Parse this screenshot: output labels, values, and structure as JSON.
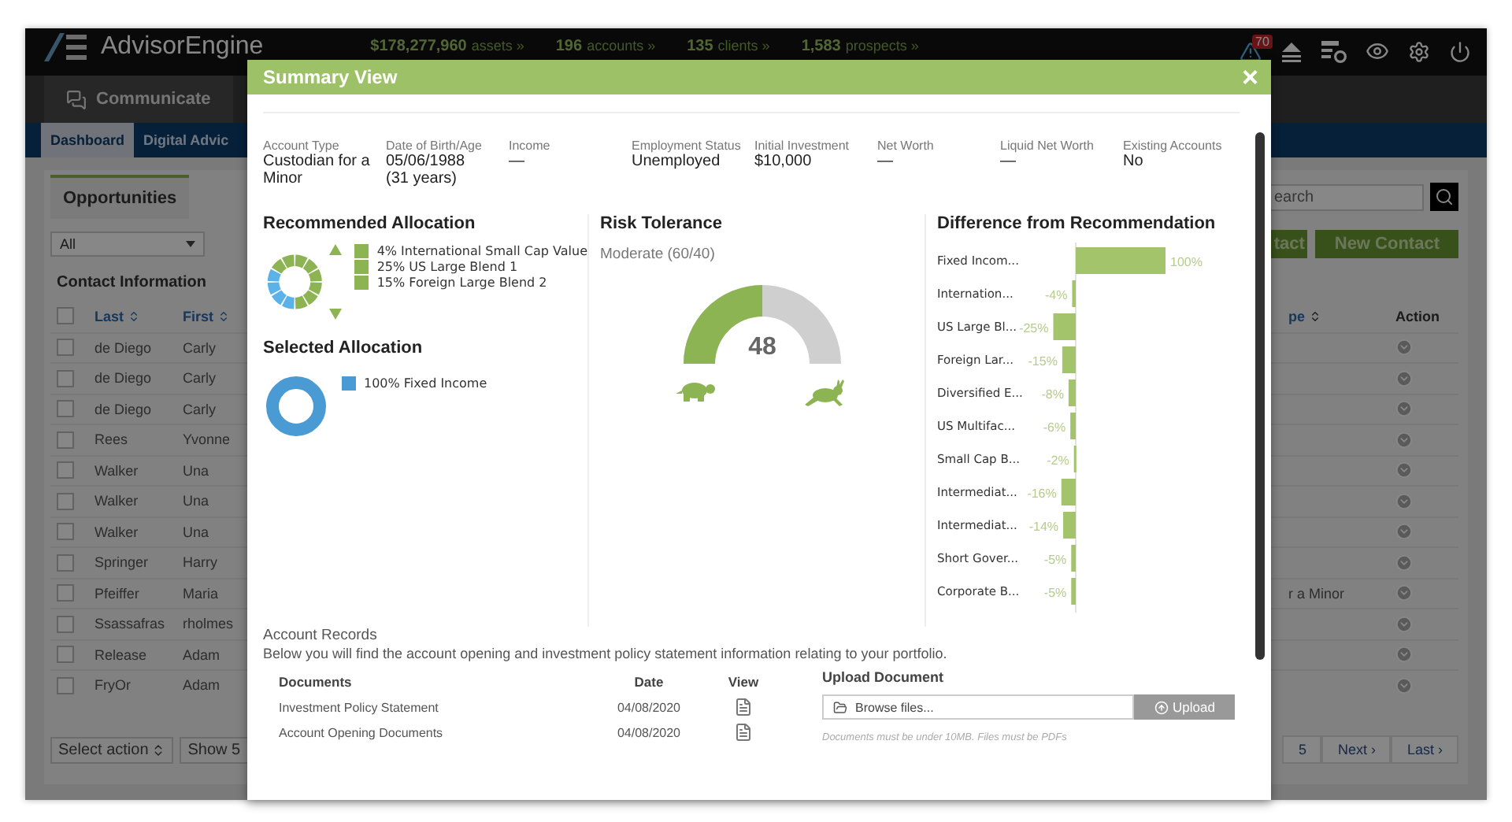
{
  "top_bar": {
    "logo": "AdvisorEngine",
    "stats": [
      {
        "value": "$178,277,960",
        "label": "assets »"
      },
      {
        "value": "196",
        "label": "accounts »"
      },
      {
        "value": "135",
        "label": "clients »"
      },
      {
        "value": "1,583",
        "label": "prospects »"
      }
    ],
    "alert_count": "70"
  },
  "nav": [
    {
      "label": "Communicate"
    }
  ],
  "tabs": [
    {
      "label": "Dashboard",
      "selected": true
    },
    {
      "label": "Digital Advic",
      "selected": false
    }
  ],
  "left_panel": {
    "tab": "Opportunities",
    "filter": "All",
    "section_title": "Contact Information"
  },
  "search": {
    "placeholder": "earch"
  },
  "buttons": [
    "tact",
    "New Contact"
  ],
  "contacts": {
    "columns": [
      "Last",
      "First",
      "pe",
      "Action"
    ],
    "select_all_checked": false,
    "rows": [
      {
        "last": "de Diego",
        "first": "Carly",
        "checked": false
      },
      {
        "last": "de Diego",
        "first": "Carly",
        "checked": false
      },
      {
        "last": "de Diego",
        "first": "Carly",
        "checked": false
      },
      {
        "last": "Rees",
        "first": "Yvonne",
        "checked": false
      },
      {
        "last": "Walker",
        "first": "Una",
        "checked": false
      },
      {
        "last": "Walker",
        "first": "Una",
        "checked": false
      },
      {
        "last": "Walker",
        "first": "Una",
        "checked": false
      },
      {
        "last": "Springer",
        "first": "Harry",
        "checked": false
      },
      {
        "last": "Pfeiffer",
        "first": "Maria",
        "type": "r a Minor",
        "checked": false
      },
      {
        "last": "Ssassafras",
        "first": "rholmes",
        "checked": false
      },
      {
        "last": "Release",
        "first": "Adam",
        "checked": false
      },
      {
        "last": "FryOr",
        "first": "Adam",
        "checked": false
      }
    ]
  },
  "bulk_action": "Select action",
  "page_size": "Show 5",
  "pagination": [
    "5",
    "Next ›",
    "Last ›"
  ],
  "modal": {
    "title": "Summary View",
    "close": "×",
    "profile": [
      {
        "label": "Account Type",
        "value": "Custodian for a Minor"
      },
      {
        "label": "Date of Birth/Age",
        "value": "05/06/1988",
        "note": "(31 years)"
      },
      {
        "label": "Income",
        "value": "—"
      },
      {
        "label": "Employment Status",
        "value": "Unemployed"
      },
      {
        "label": "Initial Investment",
        "value": "$10,000"
      },
      {
        "label": "Net Worth",
        "value": "—"
      },
      {
        "label": "Liquid Net Worth",
        "value": "—"
      },
      {
        "label": "Existing Accounts",
        "value": "No"
      }
    ],
    "recommended": {
      "title": "Recommended Allocation",
      "legend": [
        {
          "label": "4% International Small Cap Value",
          "color": "#8db452"
        },
        {
          "label": "25% US Large Blend 1",
          "color": "#8db452"
        },
        {
          "label": "15% Foreign Large Blend 2",
          "color": "#8db452"
        }
      ]
    },
    "selected": {
      "title": "Selected Allocation",
      "legend": [
        {
          "label": "100% Fixed Income",
          "color": "#4a9ad4"
        }
      ]
    },
    "risk": {
      "title": "Risk Tolerance",
      "profile": "Moderate (60/40)",
      "score": "48",
      "level": 0.5
    },
    "difference": {
      "title": "Difference from Recommendation",
      "chart_data": {
        "type": "bar",
        "orientation": "horizontal",
        "data_labels": true,
        "categories": [
          "Fixed Incom...",
          "Internation...",
          "US Large Bl...",
          "Foreign Lar...",
          "Diversified E...",
          "US Multifac...",
          "Small Cap B...",
          "Intermediat...",
          "Intermediat...",
          "Short Gover...",
          "Corporate B..."
        ],
        "values": [
          100,
          -4,
          -25,
          -15,
          -8,
          -6,
          -2,
          -16,
          -14,
          -5,
          -5
        ],
        "value_labels": [
          "100%",
          "-4%",
          "-25%",
          "-15%",
          "-8%",
          "-6%",
          "-2%",
          "-16%",
          "-14%",
          "-5%",
          "-5%"
        ]
      }
    },
    "records": {
      "title": "Account Records",
      "description": "Below you will find the account opening and investment policy statement information relating to your portfolio.",
      "columns": [
        "Documents",
        "Date",
        "View"
      ],
      "rows": [
        {
          "name": "Investment Policy Statement",
          "date": "04/08/2020"
        },
        {
          "name": "Account Opening Documents",
          "date": "04/08/2020"
        }
      ],
      "upload": {
        "title": "Upload Document",
        "browse": "Browse files...",
        "button": "Upload",
        "note": "Documents must be under 10MB. Files must be PDFs"
      }
    }
  }
}
